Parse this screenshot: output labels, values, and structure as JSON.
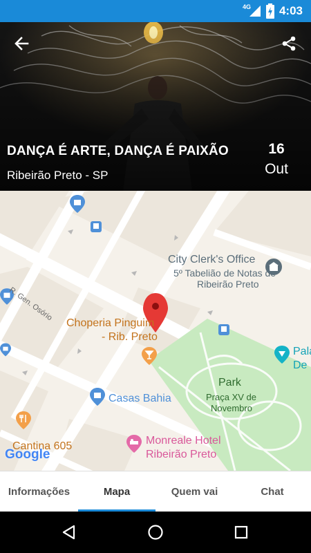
{
  "status_bar": {
    "network": "4G",
    "time": "4:03",
    "icons": [
      "signal-icon",
      "battery-charging-icon"
    ]
  },
  "header": {
    "back_icon": "arrow-left-icon",
    "share_icon": "share-icon",
    "event_title": "DANÇA É ARTE, DANÇA É PAIXÃO",
    "event_location": "Ribeirão Preto - SP",
    "event_day": "16",
    "event_month": "Out"
  },
  "map": {
    "labels": {
      "city_clerk": "City Clerk's Office",
      "tabeliao_1": "5º Tabelião de Notas de",
      "tabeliao_2": "Ribeirão Preto",
      "street": "R. Gen. Osório",
      "choperia_1": "Choperia Pinguim",
      "choperia_2": "- Rib. Preto",
      "park": "Park",
      "praca_1": "Praça XV de",
      "praca_2": "Novembro",
      "casas_bahia": "Casas Bahia",
      "cantina": "Cantina 605",
      "monreale_1": "Monreale Hotel",
      "monreale_2": "Ribeirão Preto",
      "pala_1": "Pala",
      "pala_2": "De",
      "google": "Google"
    },
    "colors": {
      "background": "#f5f1ea",
      "park": "#c8eac0",
      "block": "#ece6dc",
      "road": "#ffffff",
      "poi_orange": "#c3731c",
      "poi_blue": "#4f90d8",
      "poi_pink": "#d9589a",
      "poi_gray": "#5b6e7a",
      "marker": "#e53935"
    }
  },
  "tabs": [
    {
      "label": "Informações",
      "active": false
    },
    {
      "label": "Mapa",
      "active": true
    },
    {
      "label": "Quem vai",
      "active": false
    },
    {
      "label": "Chat",
      "active": false
    }
  ],
  "nav_bar": {
    "icons": [
      "back-triangle-icon",
      "home-circle-icon",
      "recents-square-icon"
    ]
  }
}
